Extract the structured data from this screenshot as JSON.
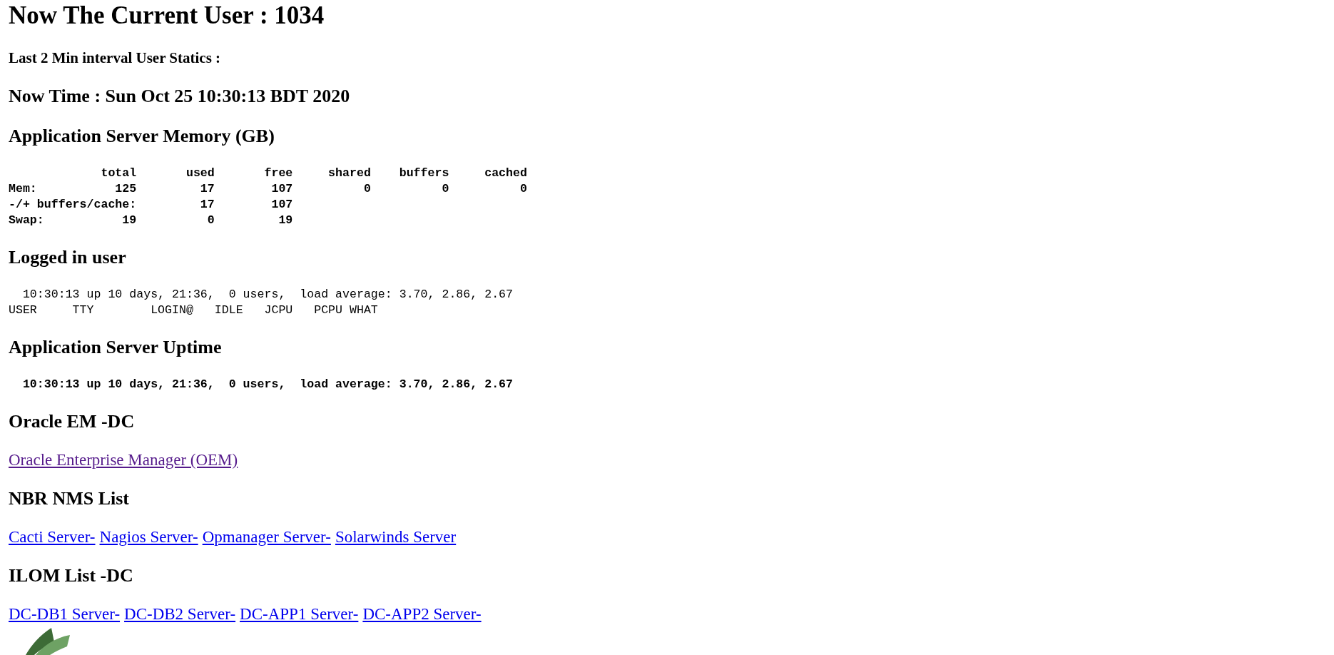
{
  "title": "Now The Current User : 1034",
  "subtitle": "Last 2 Min interval User Statics :",
  "now_time": "Now Time : Sun Oct 25 10:30:13 BDT 2020",
  "sections": [
    {
      "heading": "Application Server Memory (GB)",
      "kind": "pre",
      "bold": true,
      "lines": [
        "             total       used       free     shared    buffers     cached",
        "Mem:           125         17        107          0          0          0",
        "-/+ buffers/cache:         17        107",
        "Swap:           19          0         19"
      ]
    },
    {
      "heading": "Logged in user",
      "kind": "pre",
      "bold": false,
      "lines": [
        "  10:30:13 up 10 days, 21:36,  0 users,  load average: 3.70, 2.86, 2.67",
        "USER     TTY        LOGIN@   IDLE   JCPU   PCPU WHAT"
      ]
    },
    {
      "heading": "Application Server Uptime",
      "kind": "pre",
      "bold": true,
      "lines": [
        "  10:30:13 up 10 days, 21:36,  0 users,  load average: 3.70, 2.86, 2.67"
      ]
    },
    {
      "heading": "Oracle EM -DC",
      "kind": "links",
      "links": [
        {
          "text": "Oracle Enterprise Manager (OEM)",
          "visited": true
        }
      ]
    },
    {
      "heading": "NBR NMS List",
      "kind": "links",
      "links": [
        {
          "text": "Cacti Server-",
          "visited": false
        },
        {
          "text": "Nagios Server-",
          "visited": false
        },
        {
          "text": "Opmanager Server-",
          "visited": false
        },
        {
          "text": "Solarwinds Server",
          "visited": false
        }
      ]
    },
    {
      "heading": "ILOM List -DC",
      "kind": "links",
      "links": [
        {
          "text": "DC-DB1 Server-",
          "visited": false
        },
        {
          "text": "DC-DB2 Server-",
          "visited": false
        },
        {
          "text": "DC-APP1 Server-",
          "visited": false
        },
        {
          "text": "DC-APP2 Server-",
          "visited": false
        }
      ]
    }
  ]
}
